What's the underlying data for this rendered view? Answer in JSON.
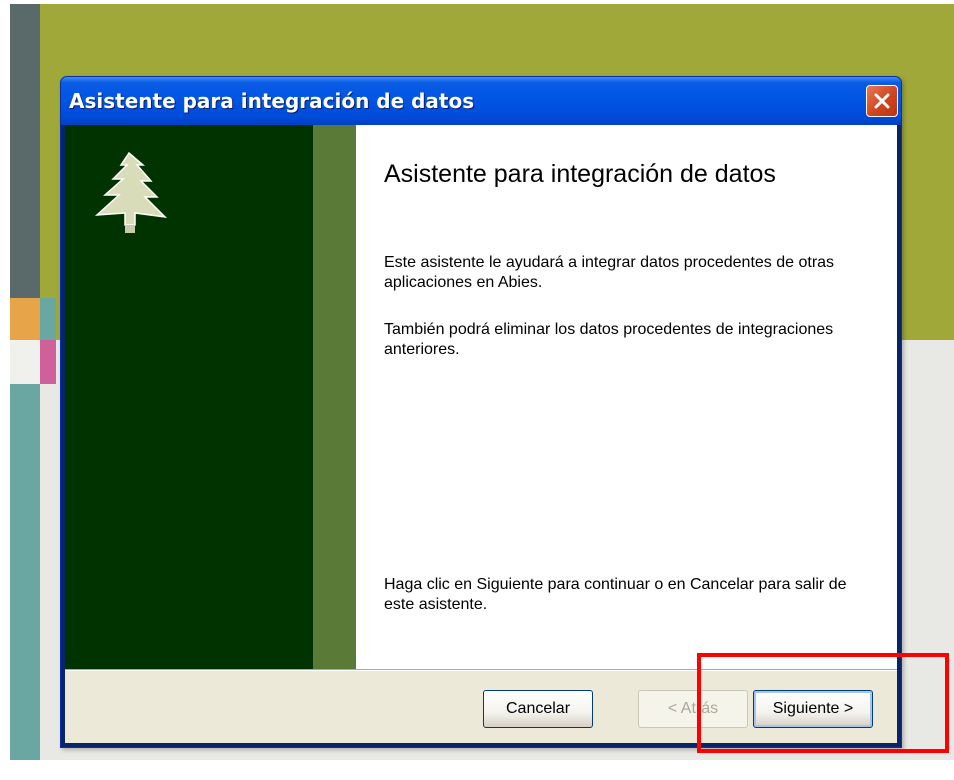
{
  "window": {
    "title": "Asistente para integración de datos"
  },
  "content": {
    "heading": "Asistente para integración de datos",
    "paragraph1": "Este asistente le ayudará a integrar datos procedentes de otras aplicaciones en Abies.",
    "paragraph2": "También podrá eliminar los datos procedentes de integraciones anteriores.",
    "paragraph3": "Haga clic en Siguiente para continuar o en Cancelar para salir de este asistente."
  },
  "buttons": {
    "cancel_label": "Cancelar",
    "back_label": "< Atrás",
    "next_mnemonic": "S",
    "next_rest": "iguiente >"
  },
  "icons": {
    "close": "close-icon",
    "logo": "fir-tree-icon"
  },
  "colors": {
    "titlebar": "#0054e3",
    "sidebar": "#003300",
    "sidebar_strip": "#5a7a38",
    "highlight": "#ff0000"
  }
}
